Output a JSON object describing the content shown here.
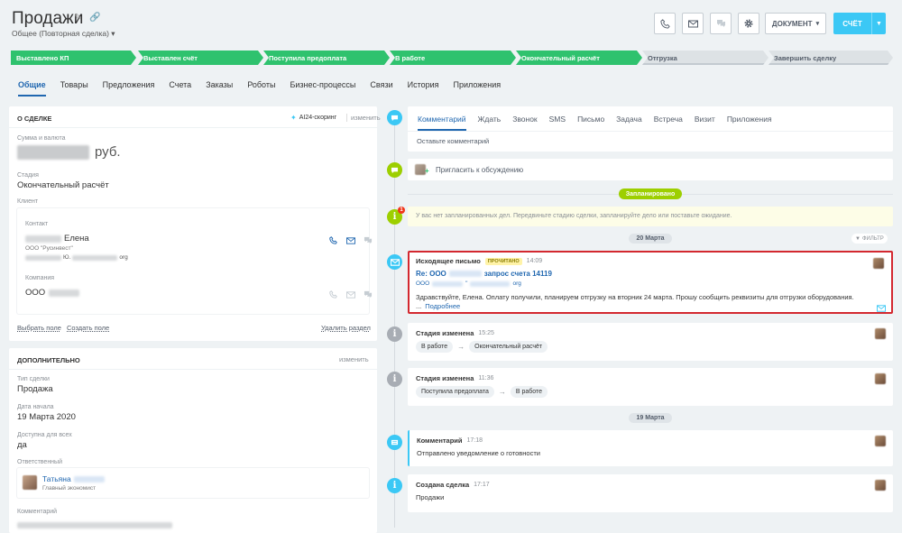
{
  "header": {
    "title": "Продажи",
    "subtitle": "Общее (Повторная сделка)",
    "document_btn": "ДОКУМЕНТ",
    "invoice_btn": "СЧЁТ"
  },
  "stages": [
    {
      "label": "Выставлено КП",
      "state": "done"
    },
    {
      "label": "Выставлен счёт",
      "state": "done"
    },
    {
      "label": "Поступила предоплата",
      "state": "done"
    },
    {
      "label": "В работе",
      "state": "done"
    },
    {
      "label": "Окончательный расчёт",
      "state": "done"
    },
    {
      "label": "Отгрузка",
      "state": "todo"
    },
    {
      "label": "Завершить сделку",
      "state": "todo"
    }
  ],
  "tabs": [
    "Общие",
    "Товары",
    "Предложения",
    "Счета",
    "Заказы",
    "Роботы",
    "Бизнес-процессы",
    "Связи",
    "История",
    "Приложения"
  ],
  "deal": {
    "section_title": "О СДЕЛКЕ",
    "scoring": "AI24-скоринг",
    "edit": "изменить",
    "amount_label": "Сумма и валюта",
    "currency": "руб.",
    "stage_label": "Стадия",
    "stage_value": "Окончательный расчёт",
    "client_label": "Клиент",
    "contact_label": "Контакт",
    "contact_name": "Елена",
    "contact_company": "ООО \"Русинвест\"",
    "contact_email_tail": "org",
    "company_label": "Компания",
    "company_name": "ООО",
    "select_field": "Выбрать поле",
    "create_field": "Создать поле",
    "delete_section": "Удалить раздел"
  },
  "extra": {
    "section_title": "ДОПОЛНИТЕЛЬНО",
    "edit": "изменить",
    "type_label": "Тип сделки",
    "type_value": "Продажа",
    "start_label": "Дата начала",
    "start_value": "19 Марта 2020",
    "access_label": "Доступна для всех",
    "access_value": "да",
    "responsible_label": "Ответственный",
    "responsible_name": "Татьяна",
    "responsible_role": "Главный экономист",
    "comment_label": "Комментарий"
  },
  "composer": {
    "tabs": [
      "Комментарий",
      "Ждать",
      "Звонок",
      "SMS",
      "Письмо",
      "Задача",
      "Встреча",
      "Визит",
      "Приложения"
    ],
    "placeholder": "Оставьте комментарий"
  },
  "invite": "Пригласить к обсуждению",
  "planned_badge": "Запланировано",
  "planned_notice": "У вас нет запланированных дел. Передвиньте стадию сделки, запланируйте дело или поставьте ожидание.",
  "filter": "ФИЛЬТР",
  "date1": "20 Марта",
  "email": {
    "title": "Исходящее письмо",
    "badge": "ПРОЧИТАНО",
    "time": "14:09",
    "subject_prefix": "Re: ООО",
    "subject_suffix": "запрос счета 14119",
    "from_prefix": "ООО",
    "from_tail": "org",
    "body": "Здравствуйте, Елена. Оплату получили, планируем отгрузку на вторник 24 марта. Прошу сообщить реквизиты для отгрузки оборудования.",
    "ellipsis": "...",
    "more": "Подробнее"
  },
  "stage_change1": {
    "title": "Стадия изменена",
    "time": "15:25",
    "from": "В работе",
    "to": "Окончательный расчёт"
  },
  "stage_change2": {
    "title": "Стадия изменена",
    "time": "11:36",
    "from": "Поступила предоплата",
    "to": "В работе"
  },
  "date2": "19 Марта",
  "comment": {
    "title": "Комментарий",
    "time": "17:18",
    "text": "Отправлено уведомление о готовности"
  },
  "created": {
    "title": "Создана сделка",
    "time": "17:17",
    "text": "Продажи"
  },
  "colors": {
    "accent": "#3bc8f5",
    "stage_done": "#2fc26e",
    "link": "#2067b0",
    "highlight": "#d3282f"
  }
}
